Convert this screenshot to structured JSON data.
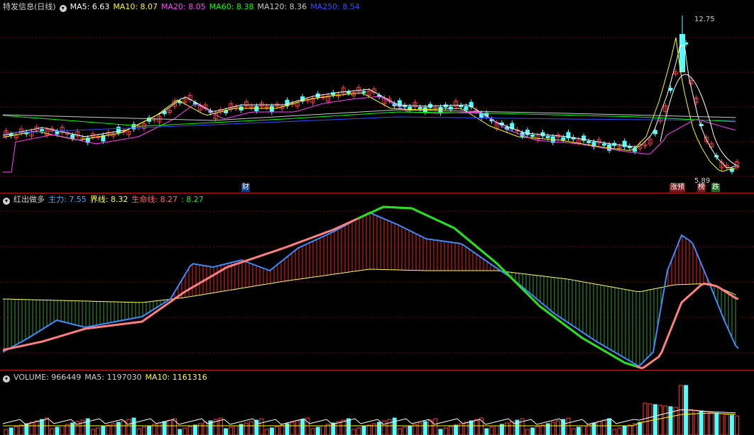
{
  "stock": {
    "name": "特发信息(日线)"
  },
  "main_indicators": [
    {
      "label": "MA5: 6.63",
      "color": "#ffffff"
    },
    {
      "label": "MA10: 8.07",
      "color": "#ffff00"
    },
    {
      "label": "MA20: 8.05",
      "color": "#ff40ff"
    },
    {
      "label": "MA60: 8.38",
      "color": "#00ff00"
    },
    {
      "label": "MA120: 8.36",
      "color": "#c8c8c8"
    },
    {
      "label": "MA250: 8.54",
      "color": "#3050ff"
    }
  ],
  "annotations": {
    "high_price": "12.75",
    "low_price": "5.89",
    "fin_badge": "财",
    "zhangyu": "涨预",
    "bang": "榜",
    "die": "跌"
  },
  "indicator": {
    "name": "红出做多",
    "items": [
      {
        "label": "主力: 7.55",
        "color": "#4aa8ff"
      },
      {
        "label": "界线: 8.32",
        "color": "#ffff60"
      },
      {
        "label": "生命线: 8.27",
        "color": "#ff6a6a"
      },
      {
        "label": ": 8.27",
        "color": "#30e030"
      }
    ]
  },
  "volume": {
    "items": [
      {
        "label": "VOLUME: 966449",
        "color": "#d0d0d0"
      },
      {
        "label": "MA5: 1197030",
        "color": "#d0d0d0"
      },
      {
        "label": "MA10: 1161316",
        "color": "#ffff00"
      }
    ]
  },
  "colors": {
    "up": "#ff3c3c",
    "down": "#54fcfc",
    "grid": "#800000",
    "border": "#b01818"
  }
}
